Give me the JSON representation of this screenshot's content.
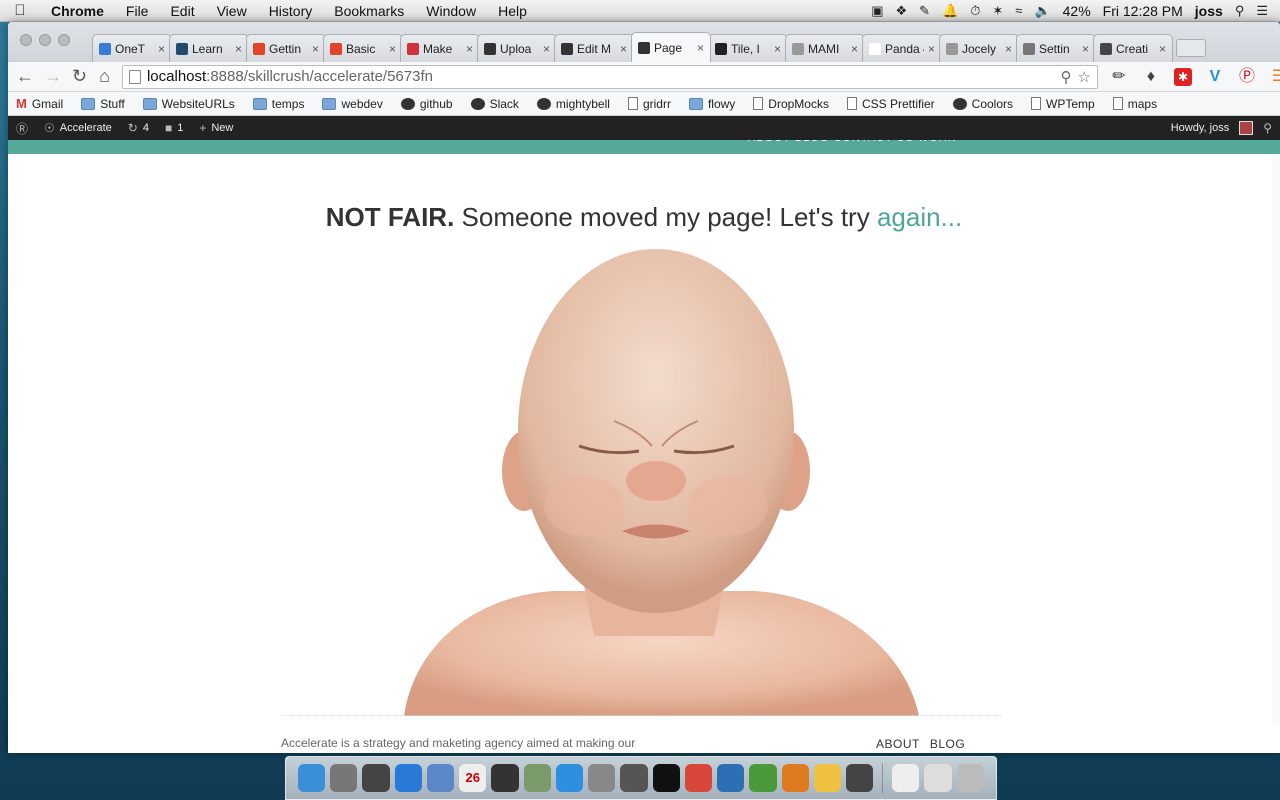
{
  "menubar": {
    "apple": "",
    "app": "Chrome",
    "items": [
      "File",
      "Edit",
      "View",
      "History",
      "Bookmarks",
      "Window",
      "Help"
    ],
    "battery": "42%",
    "clock": "Fri 12:28 PM",
    "user": "joss"
  },
  "tabs": [
    {
      "title": "OneT",
      "icon": "v-icon",
      "color": "#3a7bd5"
    },
    {
      "title": "Learn",
      "icon": "learn-icon",
      "color": "#1e4b6e"
    },
    {
      "title": "Gettin",
      "icon": "gitlab-icon",
      "color": "#e2432a"
    },
    {
      "title": "Basic",
      "icon": "gitlab-icon",
      "color": "#e2432a"
    },
    {
      "title": "Make",
      "icon": "feather-icon",
      "color": "#d0313a"
    },
    {
      "title": "Uploa",
      "icon": "github-icon",
      "color": "#333333"
    },
    {
      "title": "Edit M",
      "icon": "github-icon",
      "color": "#333333"
    },
    {
      "title": "Page",
      "icon": "github-icon",
      "color": "#333333",
      "active": true
    },
    {
      "title": "Tile, I",
      "icon": "tile-icon",
      "color": "#222222"
    },
    {
      "title": "MAMI",
      "icon": "page-icon",
      "color": "#999999"
    },
    {
      "title": "Panda 4",
      "icon": "blank-icon",
      "color": "#ffffff"
    },
    {
      "title": "Jocely",
      "icon": "page-icon",
      "color": "#999999"
    },
    {
      "title": "Settin",
      "icon": "gear-icon",
      "color": "#777777"
    },
    {
      "title": "Creati",
      "icon": "wordpress-icon",
      "color": "#464646"
    }
  ],
  "toolbar": {
    "url_host": "localhost",
    "url_path": ":8888/skillcrush/accelerate/5673fn"
  },
  "bookmarks": [
    {
      "label": "Gmail",
      "type": "gm"
    },
    {
      "label": "Stuff",
      "type": "folder"
    },
    {
      "label": "WebsiteURLs",
      "type": "folder"
    },
    {
      "label": "temps",
      "type": "folder"
    },
    {
      "label": "webdev",
      "type": "folder"
    },
    {
      "label": "github",
      "type": "round"
    },
    {
      "label": "Slack",
      "type": "round"
    },
    {
      "label": "mightybell",
      "type": "round"
    },
    {
      "label": "gridrr",
      "type": "page"
    },
    {
      "label": "flowy",
      "type": "folder"
    },
    {
      "label": "DropMocks",
      "type": "page"
    },
    {
      "label": "CSS Prettifier",
      "type": "page"
    },
    {
      "label": "Coolors",
      "type": "round"
    },
    {
      "label": "WPTemp",
      "type": "page"
    },
    {
      "label": "maps",
      "type": "page"
    }
  ],
  "wpbar": {
    "site": "Accelerate",
    "updates": "4",
    "comments": "1",
    "new": "New",
    "howdy": "Howdy, joss"
  },
  "page": {
    "headline_bold": "NOT FAIR.",
    "headline_text": " Someone moved my page! Let's try ",
    "headline_link": "again...",
    "footer_text": "Accelerate is a strategy and maketing agency aimed at making our",
    "footer_nav": [
      "ABOUT",
      "BLOG"
    ]
  },
  "dock": [
    {
      "name": "finder-icon",
      "color": "#3b8fd9"
    },
    {
      "name": "launchpad-icon",
      "color": "#777777"
    },
    {
      "name": "dashboard-icon",
      "color": "#444444"
    },
    {
      "name": "safari-icon",
      "color": "#2a79d6"
    },
    {
      "name": "mail-icon",
      "color": "#5b86c8"
    },
    {
      "name": "calendar-icon",
      "color": "#eeeeee",
      "label": "26"
    },
    {
      "name": "facetime-icon",
      "color": "#333333"
    },
    {
      "name": "preview-icon",
      "color": "#7a9a6a"
    },
    {
      "name": "appstore-icon",
      "color": "#2d8fe0"
    },
    {
      "name": "system-preferences-icon",
      "color": "#888888"
    },
    {
      "name": "mission-control-icon",
      "color": "#555555"
    },
    {
      "name": "terminal-icon",
      "color": "#111111"
    },
    {
      "name": "chrome-icon",
      "color": "#d9463b"
    },
    {
      "name": "text-editor-icon",
      "color": "#2d6fb5"
    },
    {
      "name": "evernote-icon",
      "color": "#4a9a3a"
    },
    {
      "name": "sublime-icon",
      "color": "#e07a20"
    },
    {
      "name": "pencil-icon",
      "color": "#f0c040"
    },
    {
      "name": "github-desktop-icon",
      "color": "#444444"
    },
    {
      "name": "documents-icon",
      "color": "#eeeeee"
    },
    {
      "name": "downloads-icon",
      "color": "#dddddd"
    },
    {
      "name": "trash-icon",
      "color": "#bbbbbb"
    }
  ]
}
